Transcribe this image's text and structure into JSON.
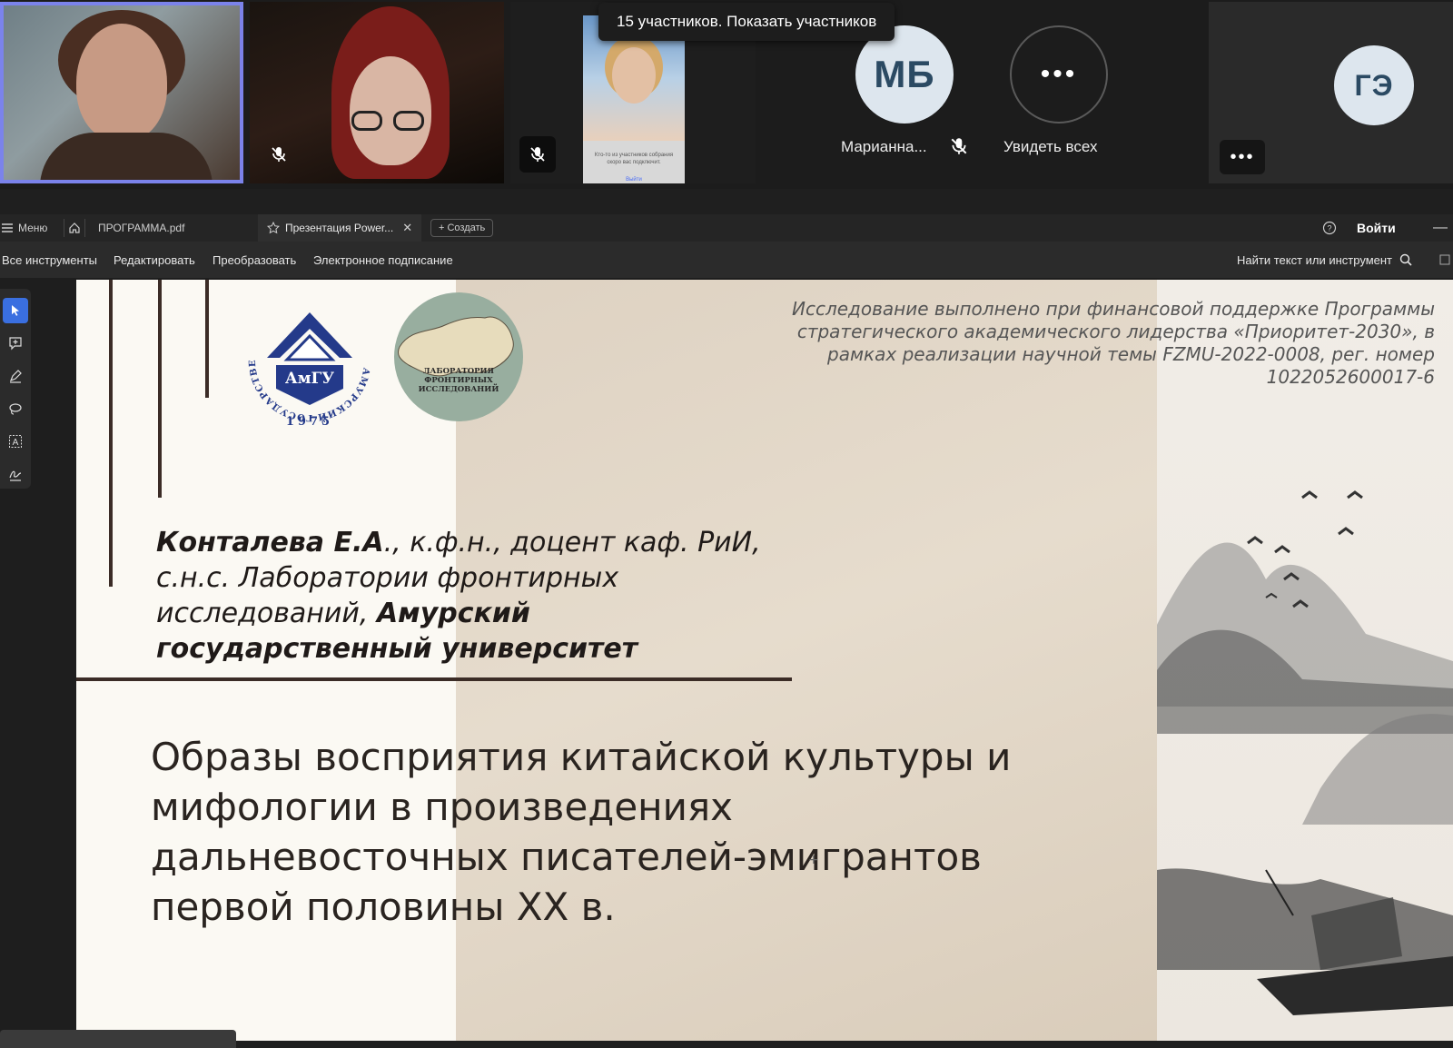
{
  "meeting": {
    "participants_tooltip": "15 участников. Показать участников",
    "tiles": [
      {
        "kind": "video",
        "active_speaker": true
      },
      {
        "kind": "video",
        "muted": true
      },
      {
        "kind": "video",
        "muted": true,
        "screen_text": "Кто-то из участников собрания скоро вас подключит.",
        "screen_link": "Выйти"
      },
      {
        "kind": "avatar",
        "initials": "МБ",
        "name": "Марианна...",
        "muted": true
      },
      {
        "kind": "see_all",
        "label": "Увидеть всех"
      },
      {
        "kind": "avatar",
        "initials": "ГЭ"
      }
    ],
    "more_label": "•••"
  },
  "app": {
    "tabbar": {
      "menu_label": "Меню",
      "tabs": [
        {
          "label": "ПРОГРАММА.pdf"
        },
        {
          "label": "Презентация Power..."
        }
      ],
      "create_label": "+ Создать",
      "signin_label": "Войти"
    },
    "toolbar": {
      "items": [
        "Все инструменты",
        "Редактировать",
        "Преобразовать",
        "Электронное подписание"
      ],
      "search_label": "Найти текст или инструмент"
    }
  },
  "slide": {
    "logo_amgu": {
      "ring_text": "АМУРСКИЙ ГОСУДАРСТВЕННЫЙ УНИВЕРСИТЕТ",
      "abbr": "АмГУ",
      "year": "1975"
    },
    "logo_lab": {
      "text": "ЛАБОРАТОРИЯ\nФРОНТИРНЫХ\nИССЛЕДОВАНИЙ"
    },
    "funding": "Исследование выполнено при финансовой поддержке Программы стратегического академического лидерства «Приоритет-2030», в рамках реализации научной темы FZMU-2022-0008, рег. номер 1022052600017-6",
    "author": {
      "name": "Конталева Е.А",
      "rest_1": "., к.ф.н., доцент каф. РиИ, с.н.с. Лаборатории фронтирных исследований, ",
      "university": "Амурский государственный университет"
    },
    "title": "Образы восприятия китайской культуры и мифологии в произведениях дальневосточных писателей-эмигрантов первой половины XX в."
  },
  "colors": {
    "active_border": "#7b83eb",
    "selected_tool": "#3a6fe0",
    "slide_bar": "#3b2c26"
  }
}
